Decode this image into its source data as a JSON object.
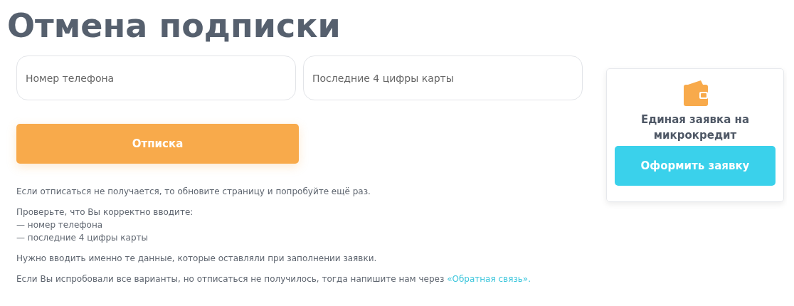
{
  "title": "Отмена подписки",
  "fields": [
    {
      "placeholder": "Номер телефона"
    },
    {
      "placeholder": "Последние 4 цифры карты"
    }
  ],
  "submit_button": "Отписка",
  "help": [
    {
      "lines": [
        "Если отписаться не получается, то обновите страницу и попробуйте ещё раз."
      ]
    },
    {
      "lines": [
        "Проверьте, что Вы корректно вводите:",
        "— номер телефона",
        "— последние 4 цифры карты"
      ]
    },
    {
      "lines": [
        "Нужно вводить именно те данные, которые оставляли при заполнении заявки."
      ]
    },
    {
      "lines": [
        "Если Вы испробовали все варианты, но отписаться не получилось, тогда напишите нам через"
      ],
      "link": "«Обратная связь»."
    }
  ],
  "promo_card": {
    "title": "Единая заявка на микрокредит",
    "button": "Оформить заявку"
  }
}
